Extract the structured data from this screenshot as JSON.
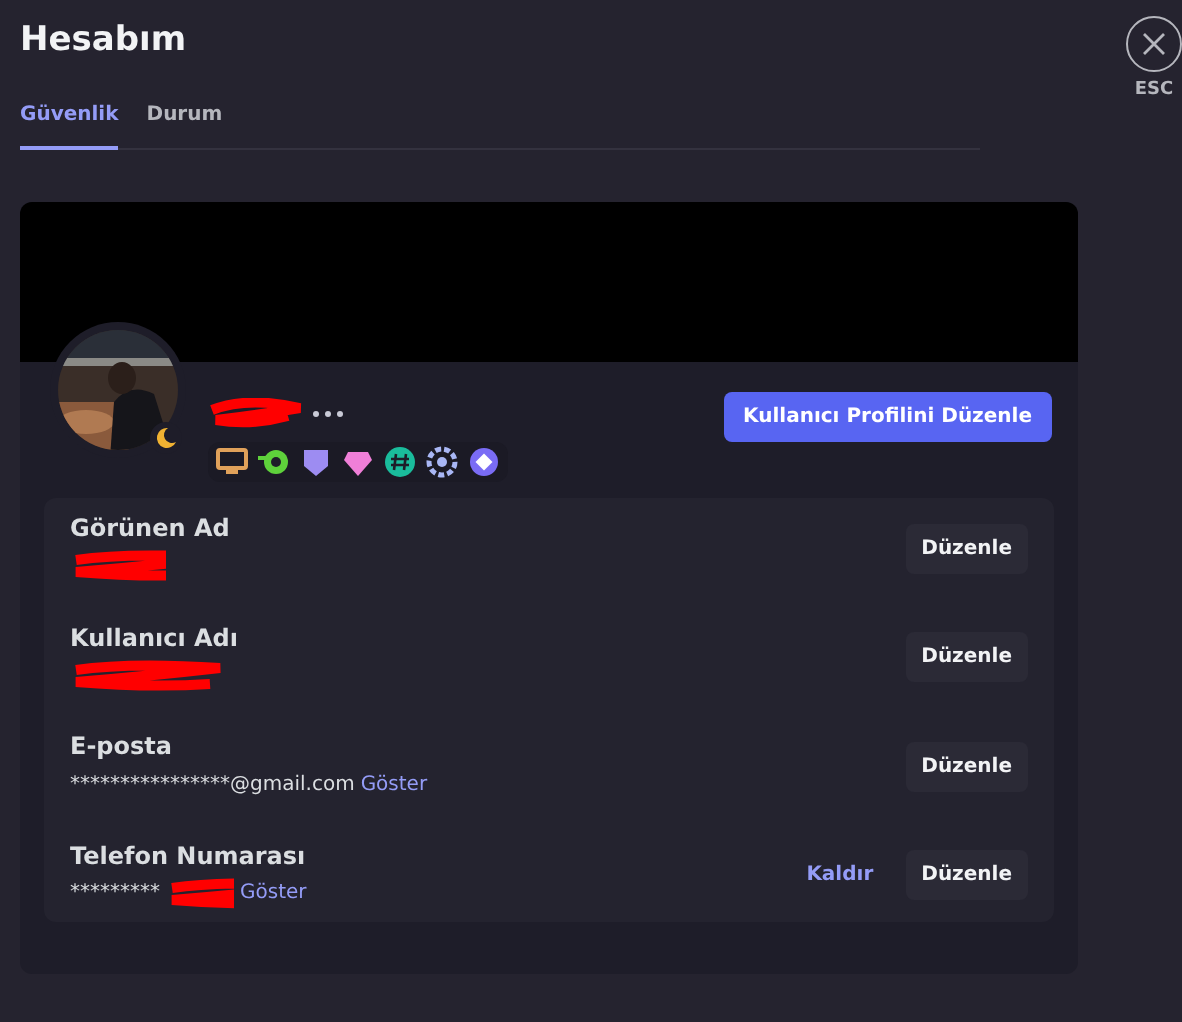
{
  "title": "Hesabım",
  "tabs": [
    {
      "label": "Güvenlik",
      "selected": true
    },
    {
      "label": "Durum",
      "selected": false
    }
  ],
  "close": {
    "label": "ESC"
  },
  "profile": {
    "name_redacted": true,
    "edit_button": "Kullanıcı Profilini Düzenle",
    "badges": [
      {
        "kind": "monitor",
        "color": "#e0a15a"
      },
      {
        "kind": "nitro",
        "color": "#5ed13b"
      },
      {
        "kind": "shield",
        "color": "#9d8cf2"
      },
      {
        "kind": "gem",
        "color": "#f07fd8"
      },
      {
        "kind": "hash",
        "color": "#1abc9c"
      },
      {
        "kind": "laurel",
        "color": "#a9b7f5"
      },
      {
        "kind": "orb",
        "color": "#7a6cf5"
      }
    ]
  },
  "fields": [
    {
      "label": "Görünen Ad",
      "redacted": true,
      "button": "Düzenle"
    },
    {
      "label": "Kullanıcı Adı",
      "redacted": true,
      "button": "Düzenle"
    },
    {
      "label": "E-posta",
      "value": "****************@gmail.com",
      "redacted": false,
      "reveal": "Göster",
      "button": "Düzenle"
    },
    {
      "label": "Telefon Numarası",
      "value": "*********",
      "redacted": true,
      "reveal": "Göster",
      "remove": "Kaldır",
      "button": "Düzenle"
    }
  ]
}
